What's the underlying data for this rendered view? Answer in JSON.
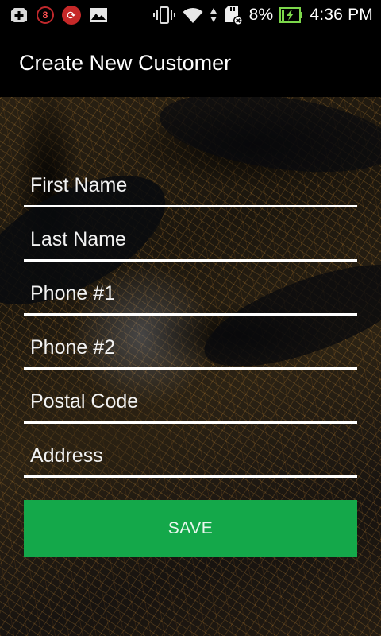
{
  "status_bar": {
    "icons_left": [
      "add-box-icon",
      "notification-count-icon",
      "sync-icon",
      "image-icon"
    ],
    "notification_count": "8",
    "icons_right": [
      "vibrate-icon",
      "wifi-icon",
      "data-arrows-icon",
      "sd-card-error-icon",
      "battery-charging-icon"
    ],
    "battery_percent": "8%",
    "battery_color": "#7cd74b",
    "time": "4:36 PM"
  },
  "app_bar": {
    "title": "Create New Customer"
  },
  "form": {
    "fields": [
      {
        "placeholder": "First Name",
        "value": ""
      },
      {
        "placeholder": "Last Name",
        "value": ""
      },
      {
        "placeholder": "Phone #1",
        "value": ""
      },
      {
        "placeholder": "Phone #2",
        "value": ""
      },
      {
        "placeholder": "Postal Code",
        "value": ""
      },
      {
        "placeholder": "Address",
        "value": ""
      }
    ],
    "save_label": "SAVE"
  },
  "colors": {
    "accent": "#14a84a",
    "background": "#000000",
    "text": "#ffffff"
  }
}
